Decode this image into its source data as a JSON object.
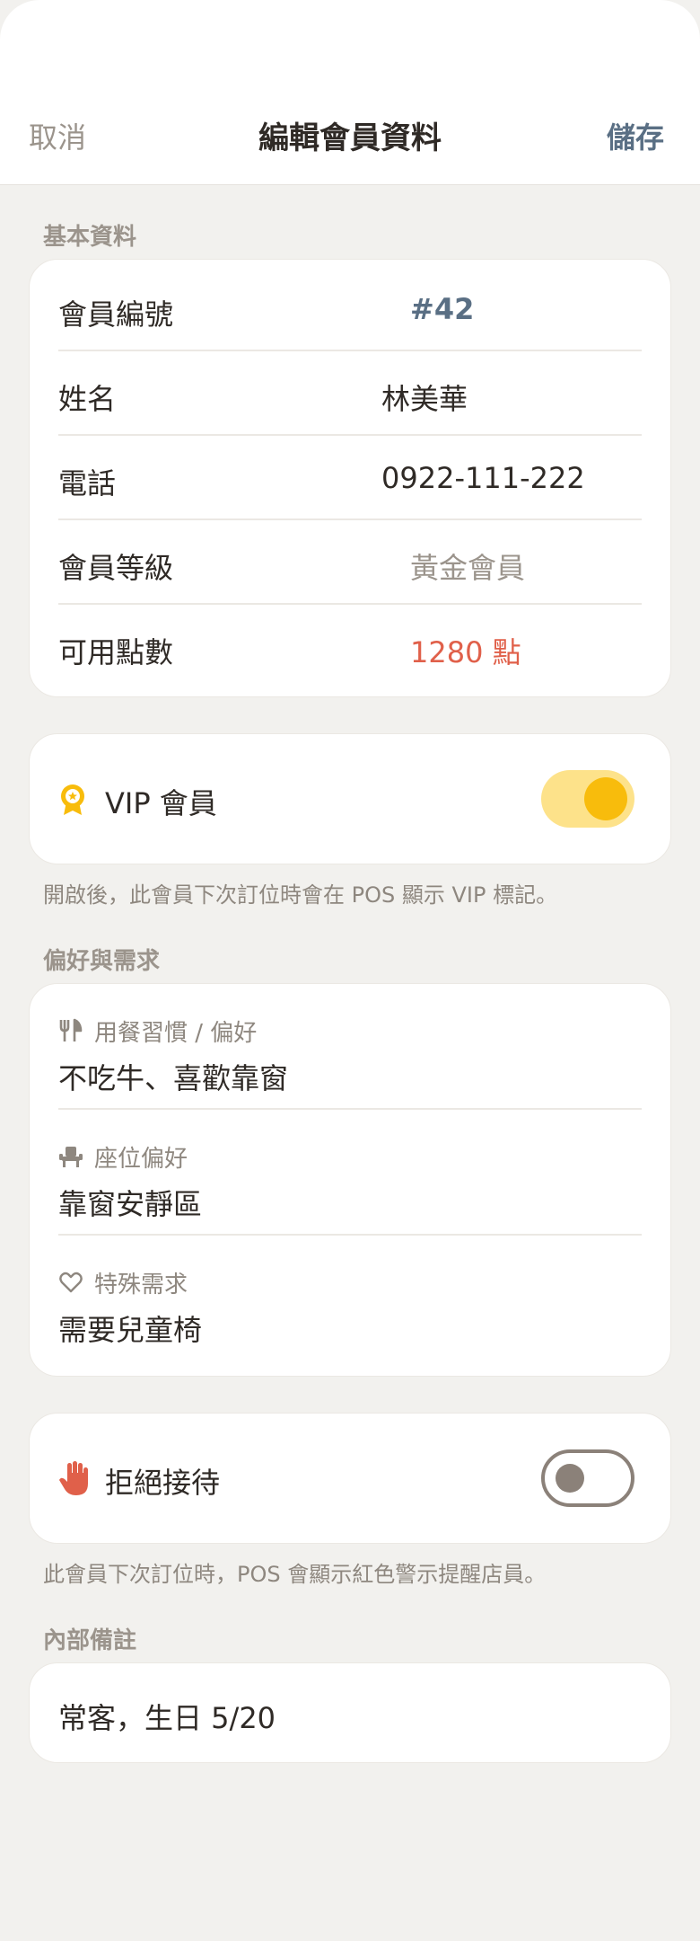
{
  "nav": {
    "cancel": "取消",
    "title": "編輯會員資料",
    "save": "儲存"
  },
  "basic": {
    "section_title": "基本資料",
    "rows": [
      {
        "label": "會員編號",
        "value": "#42",
        "color": "#5a6f84"
      },
      {
        "label": "姓名",
        "value": "林美華",
        "color": "#2f2a26"
      },
      {
        "label": "電話",
        "value": "0922-111-222",
        "color": "#2f2a26"
      },
      {
        "label": "會員等級",
        "value": "黃金會員",
        "color": "#9b948c"
      },
      {
        "label": "可用點數",
        "value": "1280 點",
        "color": "#e0604a"
      }
    ]
  },
  "vip": {
    "label": "VIP 會員",
    "enabled": true,
    "icon": "award-badge-icon",
    "footnote": "開啟後，此會員下次訂位時會在 POS 顯示 VIP 標記。"
  },
  "preferences": {
    "section_title": "偏好與需求",
    "items": [
      {
        "icon": "utensils-icon",
        "title": "用餐習慣 / 偏好",
        "value": "不吃牛、喜歡靠窗"
      },
      {
        "icon": "chair-icon",
        "title": "座位偏好",
        "value": "靠窗安靜區"
      },
      {
        "icon": "heart-icon",
        "title": "特殊需求",
        "value": "需要兒童椅"
      }
    ]
  },
  "refuse": {
    "label": "拒絕接待",
    "enabled": false,
    "icon": "hand-stop-icon",
    "footnote": "此會員下次訂位時，POS 會顯示紅色警示提醒店員。"
  },
  "notes": {
    "section_title": "內部備註",
    "value": "常客，生日 5/20"
  },
  "colors": {
    "accent": "#5a6f84",
    "vip_yellow": "#f8bc0c",
    "danger": "#e0604a"
  }
}
